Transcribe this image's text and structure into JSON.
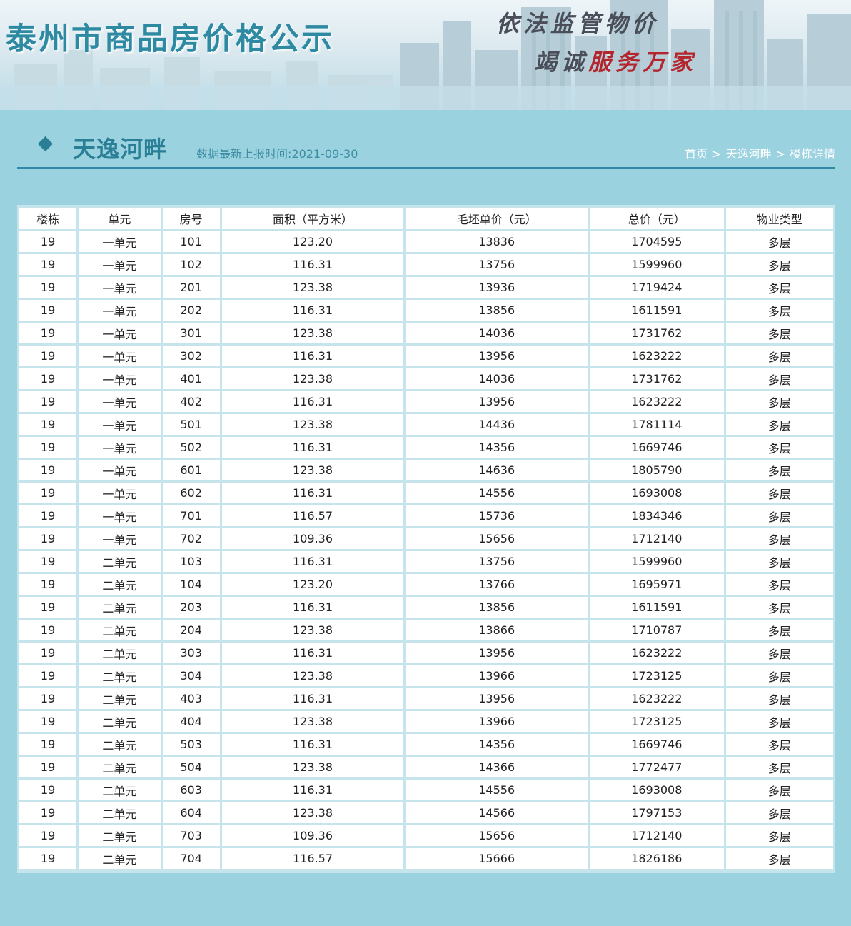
{
  "banner": {
    "site_title": "泰州市商品房价格公示",
    "slogan_line1": "依法监管物价",
    "slogan_line2_part1": "竭诚",
    "slogan_line2_part2": "服务万家"
  },
  "heading": {
    "project_name": "天逸河畔",
    "report_time": "数据最新上报时间:2021-09-30"
  },
  "breadcrumb": {
    "items": [
      "首页",
      "天逸河畔",
      "楼栋详情"
    ],
    "separator": ">"
  },
  "table": {
    "columns": [
      "楼栋",
      "单元",
      "房号",
      "面积（平方米）",
      "毛坯单价（元）",
      "总价（元）",
      "物业类型"
    ],
    "rows": [
      [
        "19",
        "一单元",
        "101",
        "123.20",
        "13836",
        "1704595",
        "多层"
      ],
      [
        "19",
        "一单元",
        "102",
        "116.31",
        "13756",
        "1599960",
        "多层"
      ],
      [
        "19",
        "一单元",
        "201",
        "123.38",
        "13936",
        "1719424",
        "多层"
      ],
      [
        "19",
        "一单元",
        "202",
        "116.31",
        "13856",
        "1611591",
        "多层"
      ],
      [
        "19",
        "一单元",
        "301",
        "123.38",
        "14036",
        "1731762",
        "多层"
      ],
      [
        "19",
        "一单元",
        "302",
        "116.31",
        "13956",
        "1623222",
        "多层"
      ],
      [
        "19",
        "一单元",
        "401",
        "123.38",
        "14036",
        "1731762",
        "多层"
      ],
      [
        "19",
        "一单元",
        "402",
        "116.31",
        "13956",
        "1623222",
        "多层"
      ],
      [
        "19",
        "一单元",
        "501",
        "123.38",
        "14436",
        "1781114",
        "多层"
      ],
      [
        "19",
        "一单元",
        "502",
        "116.31",
        "14356",
        "1669746",
        "多层"
      ],
      [
        "19",
        "一单元",
        "601",
        "123.38",
        "14636",
        "1805790",
        "多层"
      ],
      [
        "19",
        "一单元",
        "602",
        "116.31",
        "14556",
        "1693008",
        "多层"
      ],
      [
        "19",
        "一单元",
        "701",
        "116.57",
        "15736",
        "1834346",
        "多层"
      ],
      [
        "19",
        "一单元",
        "702",
        "109.36",
        "15656",
        "1712140",
        "多层"
      ],
      [
        "19",
        "二单元",
        "103",
        "116.31",
        "13756",
        "1599960",
        "多层"
      ],
      [
        "19",
        "二单元",
        "104",
        "123.20",
        "13766",
        "1695971",
        "多层"
      ],
      [
        "19",
        "二单元",
        "203",
        "116.31",
        "13856",
        "1611591",
        "多层"
      ],
      [
        "19",
        "二单元",
        "204",
        "123.38",
        "13866",
        "1710787",
        "多层"
      ],
      [
        "19",
        "二单元",
        "303",
        "116.31",
        "13956",
        "1623222",
        "多层"
      ],
      [
        "19",
        "二单元",
        "304",
        "123.38",
        "13966",
        "1723125",
        "多层"
      ],
      [
        "19",
        "二单元",
        "403",
        "116.31",
        "13956",
        "1623222",
        "多层"
      ],
      [
        "19",
        "二单元",
        "404",
        "123.38",
        "13966",
        "1723125",
        "多层"
      ],
      [
        "19",
        "二单元",
        "503",
        "116.31",
        "14356",
        "1669746",
        "多层"
      ],
      [
        "19",
        "二单元",
        "504",
        "123.38",
        "14366",
        "1772477",
        "多层"
      ],
      [
        "19",
        "二单元",
        "603",
        "116.31",
        "14556",
        "1693008",
        "多层"
      ],
      [
        "19",
        "二单元",
        "604",
        "123.38",
        "14566",
        "1797153",
        "多层"
      ],
      [
        "19",
        "二单元",
        "703",
        "109.36",
        "15656",
        "1712140",
        "多层"
      ],
      [
        "19",
        "二单元",
        "704",
        "116.57",
        "15666",
        "1826186",
        "多层"
      ]
    ]
  }
}
